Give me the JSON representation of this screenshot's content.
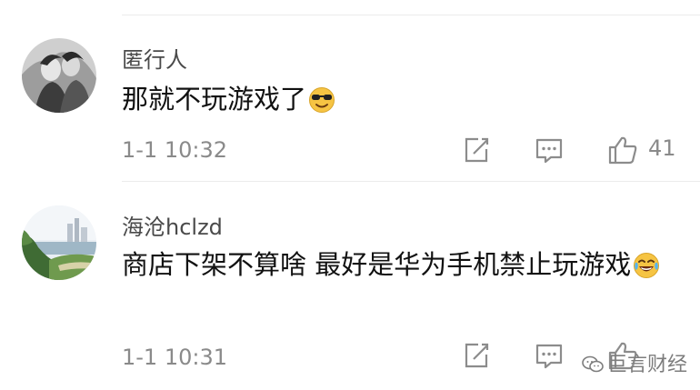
{
  "comments": [
    {
      "username": "匿行人",
      "text": "那就不玩游戏了",
      "emoji": "cool-sunglasses-emoji",
      "time": "1-1 10:32",
      "likes": "41"
    },
    {
      "username": "海沧hclzd",
      "text": "商店下架不算啥 最好是华为手机禁止玩游戏",
      "emoji": "tears-of-joy-emoji",
      "time": "1-1 10:31",
      "likes": ""
    }
  ],
  "watermark": "巨言财经",
  "icons": {
    "share": "share-edit-icon",
    "reply": "comment-bubble-icon",
    "like": "thumbs-up-icon",
    "watermark": "wechat-icon"
  },
  "colors": {
    "meta": "#8a8a8a",
    "icon": "#8c8c8c",
    "emoji_yellow": "#f6c443"
  }
}
